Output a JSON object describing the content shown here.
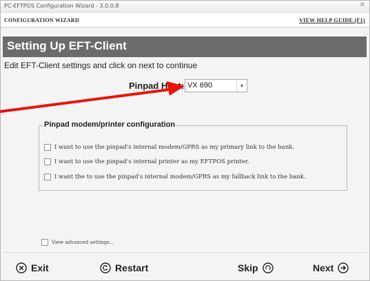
{
  "window": {
    "title": "PC-EFTPOS Configuration Wizard - 3.0.0.8",
    "close_glyph": "✕"
  },
  "header": {
    "wizard_label": "CONFIGURATION WIZARD",
    "help_link": "VIEW HELP GUIDE (F1)"
  },
  "page": {
    "heading": "Setting Up EFT-Client",
    "instruction": "Edit EFT-Client settings and click on next to continue"
  },
  "pinpad": {
    "label": "Pinpad Host:",
    "selected": "VX 690"
  },
  "group": {
    "legend": "Pinpad modem/printer configuration",
    "options": [
      {
        "label": "I want to use the pinpad's internal modem/GPRS as my primary link to the bank.",
        "checked": false
      },
      {
        "label": "I want to use the pinpad's internal printer as my EFTPOS printer.",
        "checked": false
      },
      {
        "label": "I want the to use the pinpad's internal modem/GPRS as my fallback link to the bank.",
        "checked": false
      }
    ]
  },
  "advanced": {
    "label": "View advanced settings...",
    "checked": false
  },
  "footer": {
    "exit": "Exit",
    "restart": "Restart",
    "skip": "Skip",
    "next": "Next"
  },
  "icons": {
    "exit": "close-circle-icon",
    "restart": "restart-circle-icon",
    "skip": "skip-circle-icon",
    "next": "arrow-right-circle-icon"
  },
  "colors": {
    "banner": "#6b6b6b",
    "annotation_arrow": "#e8140c"
  }
}
